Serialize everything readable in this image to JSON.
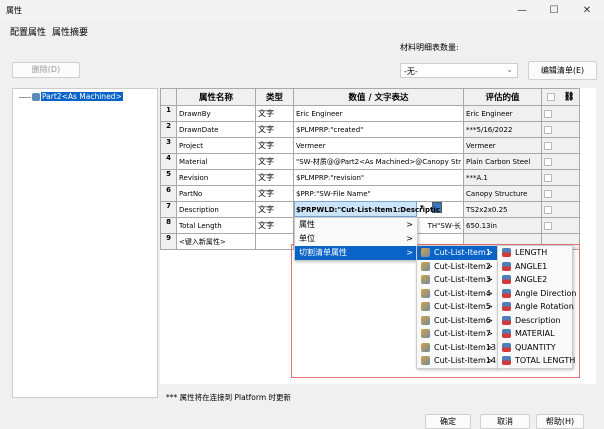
{
  "window": {
    "title": "属性",
    "controls": [
      "—",
      "☐",
      "✕"
    ]
  },
  "tabs": [
    "配置属性",
    "属性摘要"
  ],
  "delete_button": "删除(D)",
  "bom_qty": {
    "label": "材料明细表数量:",
    "value": "-无-"
  },
  "edit_list_button": "编辑清单(E)",
  "tree": {
    "item": "Part2<As Machined>"
  },
  "table": {
    "headers": [
      "属性名称",
      "类型",
      "数值 / 文字表达",
      "评估的值"
    ],
    "rows": [
      {
        "n": "1",
        "name": "DrawnBy",
        "type": "文字",
        "value": "Eric Engineer",
        "eval": "Eric Engineer"
      },
      {
        "n": "2",
        "name": "DrawnDate",
        "type": "文字",
        "value": "$PLMPRP:\"created\"",
        "eval": "***5/16/2022"
      },
      {
        "n": "3",
        "name": "Project",
        "type": "文字",
        "value": "Vermeer",
        "eval": "Vermeer"
      },
      {
        "n": "4",
        "name": "Material",
        "type": "文字",
        "value": "\"SW-材质@@Part2<As Machined>@Canopy Str",
        "eval": "Plain Carbon Steel"
      },
      {
        "n": "5",
        "name": "Revision",
        "type": "文字",
        "value": "$PLMPRP:\"revision\"",
        "eval": "***A.1"
      },
      {
        "n": "6",
        "name": "PartNo",
        "type": "文字",
        "value": "$PRP:\"SW-File Name\"",
        "eval": "Canopy Structure"
      },
      {
        "n": "7",
        "name": "Description",
        "type": "文字",
        "value": "$PRPWLD:\"Cut-List-Item1:Descriptic",
        "eval": "TS2x2x0.25"
      },
      {
        "n": "8",
        "name": "Total Length",
        "type": "文字",
        "value": "TH\"SW-长",
        "eval": "650.13in"
      },
      {
        "n": "9",
        "name": "<键入新属性>",
        "type": "",
        "value": "",
        "eval": ""
      }
    ]
  },
  "menu1": [
    {
      "label": "属性"
    },
    {
      "label": "单位"
    },
    {
      "label": "切割清单属性"
    }
  ],
  "menu2": [
    "Cut-List-Item1",
    "Cut-List-Item2",
    "Cut-List-Item3",
    "Cut-List-Item4",
    "Cut-List-Item5",
    "Cut-List-Item6",
    "Cut-List-Item7",
    "Cut-List-Item13",
    "Cut-List-Item14"
  ],
  "menu3": [
    "LENGTH",
    "ANGLE1",
    "ANGLE2",
    "Angle Direction",
    "Angle Rotation",
    "Description",
    "MATERIAL",
    "QUANTITY",
    "TOTAL LENGTH"
  ],
  "footer_note": "*** 属性将在连接到 Platform 时更新",
  "buttons": {
    "ok": "确定",
    "cancel": "取消",
    "help": "帮助(H)"
  }
}
